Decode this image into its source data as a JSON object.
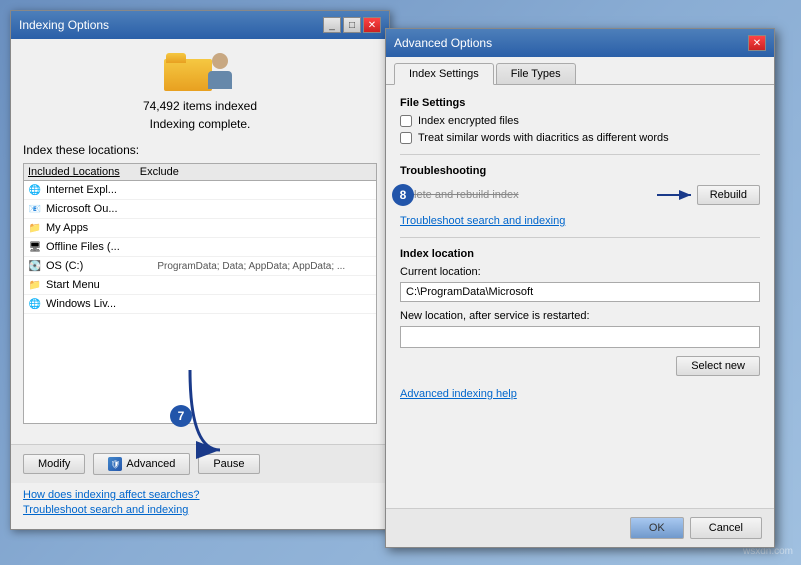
{
  "background": {
    "color": "#4a6fa5"
  },
  "indexing_window": {
    "title": "Indexing Options",
    "items_count": "74,492 items indexed",
    "status": "Indexing complete.",
    "index_label": "Index these locations:",
    "locations_header": {
      "included": "Included Locations",
      "exclude": "Exclude"
    },
    "locations": [
      {
        "icon": "🌐",
        "name": "Internet Expl..."
      },
      {
        "icon": "📧",
        "name": "Microsoft Ou..."
      },
      {
        "icon": "📁",
        "name": "My Apps"
      },
      {
        "icon": "🖥",
        "name": "Offline Files (..."
      },
      {
        "icon": "💽",
        "name": "OS (C:)",
        "path": "ProgramData; Data; AppData; AppData; ..."
      },
      {
        "icon": "📁",
        "name": "Start Menu"
      },
      {
        "icon": "🌐",
        "name": "Windows Liv..."
      }
    ],
    "buttons": {
      "modify": "Modify",
      "advanced": "Advanced",
      "pause": "Pause"
    },
    "footer_links": {
      "how_does": "How does indexing affect searches?",
      "troubleshoot": "Troubleshoot search and indexing"
    }
  },
  "advanced_dialog": {
    "title": "Advanced Options",
    "tabs": {
      "index_settings": "Index Settings",
      "file_types": "File Types"
    },
    "file_settings": {
      "label": "File Settings",
      "checkbox1": "Index encrypted files",
      "checkbox2": "Treat similar words with diacritics as different words"
    },
    "troubleshooting": {
      "label": "Troubleshooting",
      "rebuild_label": "Delete and rebuild index",
      "rebuild_btn": "Rebuild",
      "troubleshoot_link": "Troubleshoot search and indexing"
    },
    "index_location": {
      "label": "Index location",
      "current_label": "Current location:",
      "current_value": "C:\\ProgramData\\Microsoft",
      "new_label": "New location, after service is restarted:",
      "new_value": "",
      "select_new_btn": "Select new",
      "adv_help": "Advanced indexing help"
    },
    "footer": {
      "ok": "OK",
      "cancel": "Cancel"
    }
  },
  "steps": {
    "step7_label": "7",
    "step8_label": "8"
  },
  "watermark": "wsxdn.com"
}
